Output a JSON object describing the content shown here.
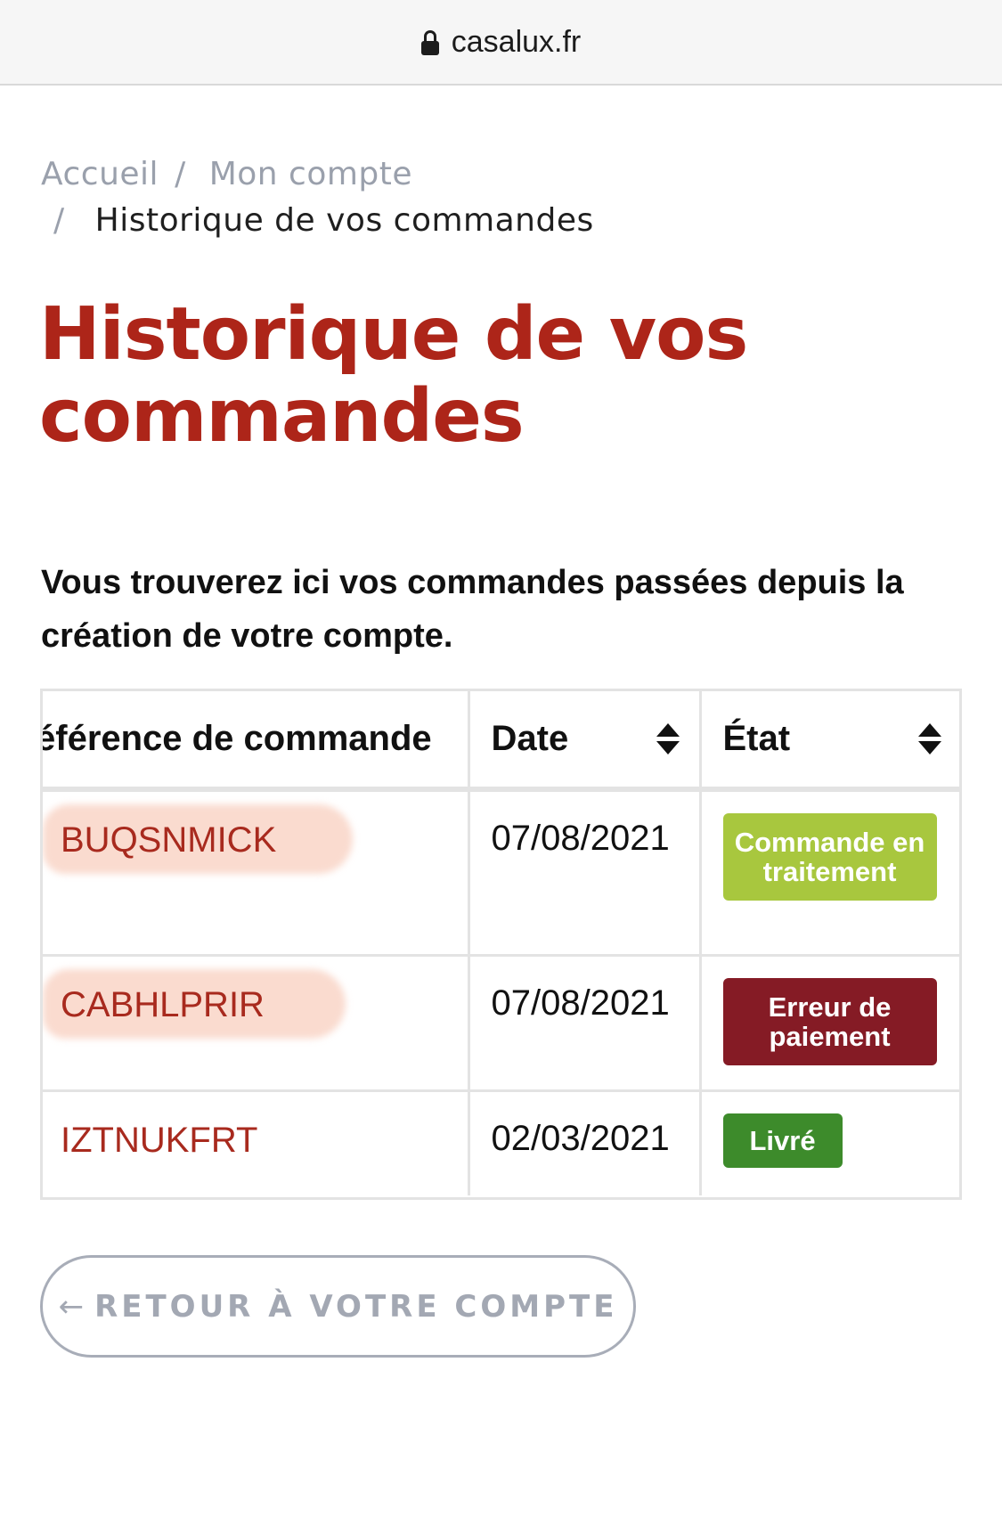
{
  "browser": {
    "url": "casalux.fr"
  },
  "breadcrumb": {
    "home": "Accueil",
    "account": "Mon compte",
    "current": "Historique de vos commandes",
    "separator": "/"
  },
  "page": {
    "title_line1": "Historique de vos",
    "title_line2": "commandes",
    "intro": "Vous trouverez ici vos commandes passées depuis la création de votre compte."
  },
  "table": {
    "headers": {
      "reference": "éférence de commande",
      "date": "Date",
      "state": "État"
    },
    "rows": [
      {
        "reference": "BUQSNMICK",
        "date": "07/08/2021",
        "state": "Commande en traitement",
        "state_color": "#a8c73e"
      },
      {
        "reference": "CABHLPRIR",
        "date": "07/08/2021",
        "state": "Erreur de paiement",
        "state_color": "#851b25"
      },
      {
        "reference": "IZTNUKFRT",
        "date": "02/03/2021",
        "state": "Livré",
        "state_color": "#3d8b2b"
      }
    ]
  },
  "back_button": {
    "arrow": "←",
    "label": "RETOUR À VOTRE COMPTE"
  },
  "colors": {
    "accent": "#ad2519",
    "link": "#a82a1e",
    "muted": "#9aa0ac"
  }
}
